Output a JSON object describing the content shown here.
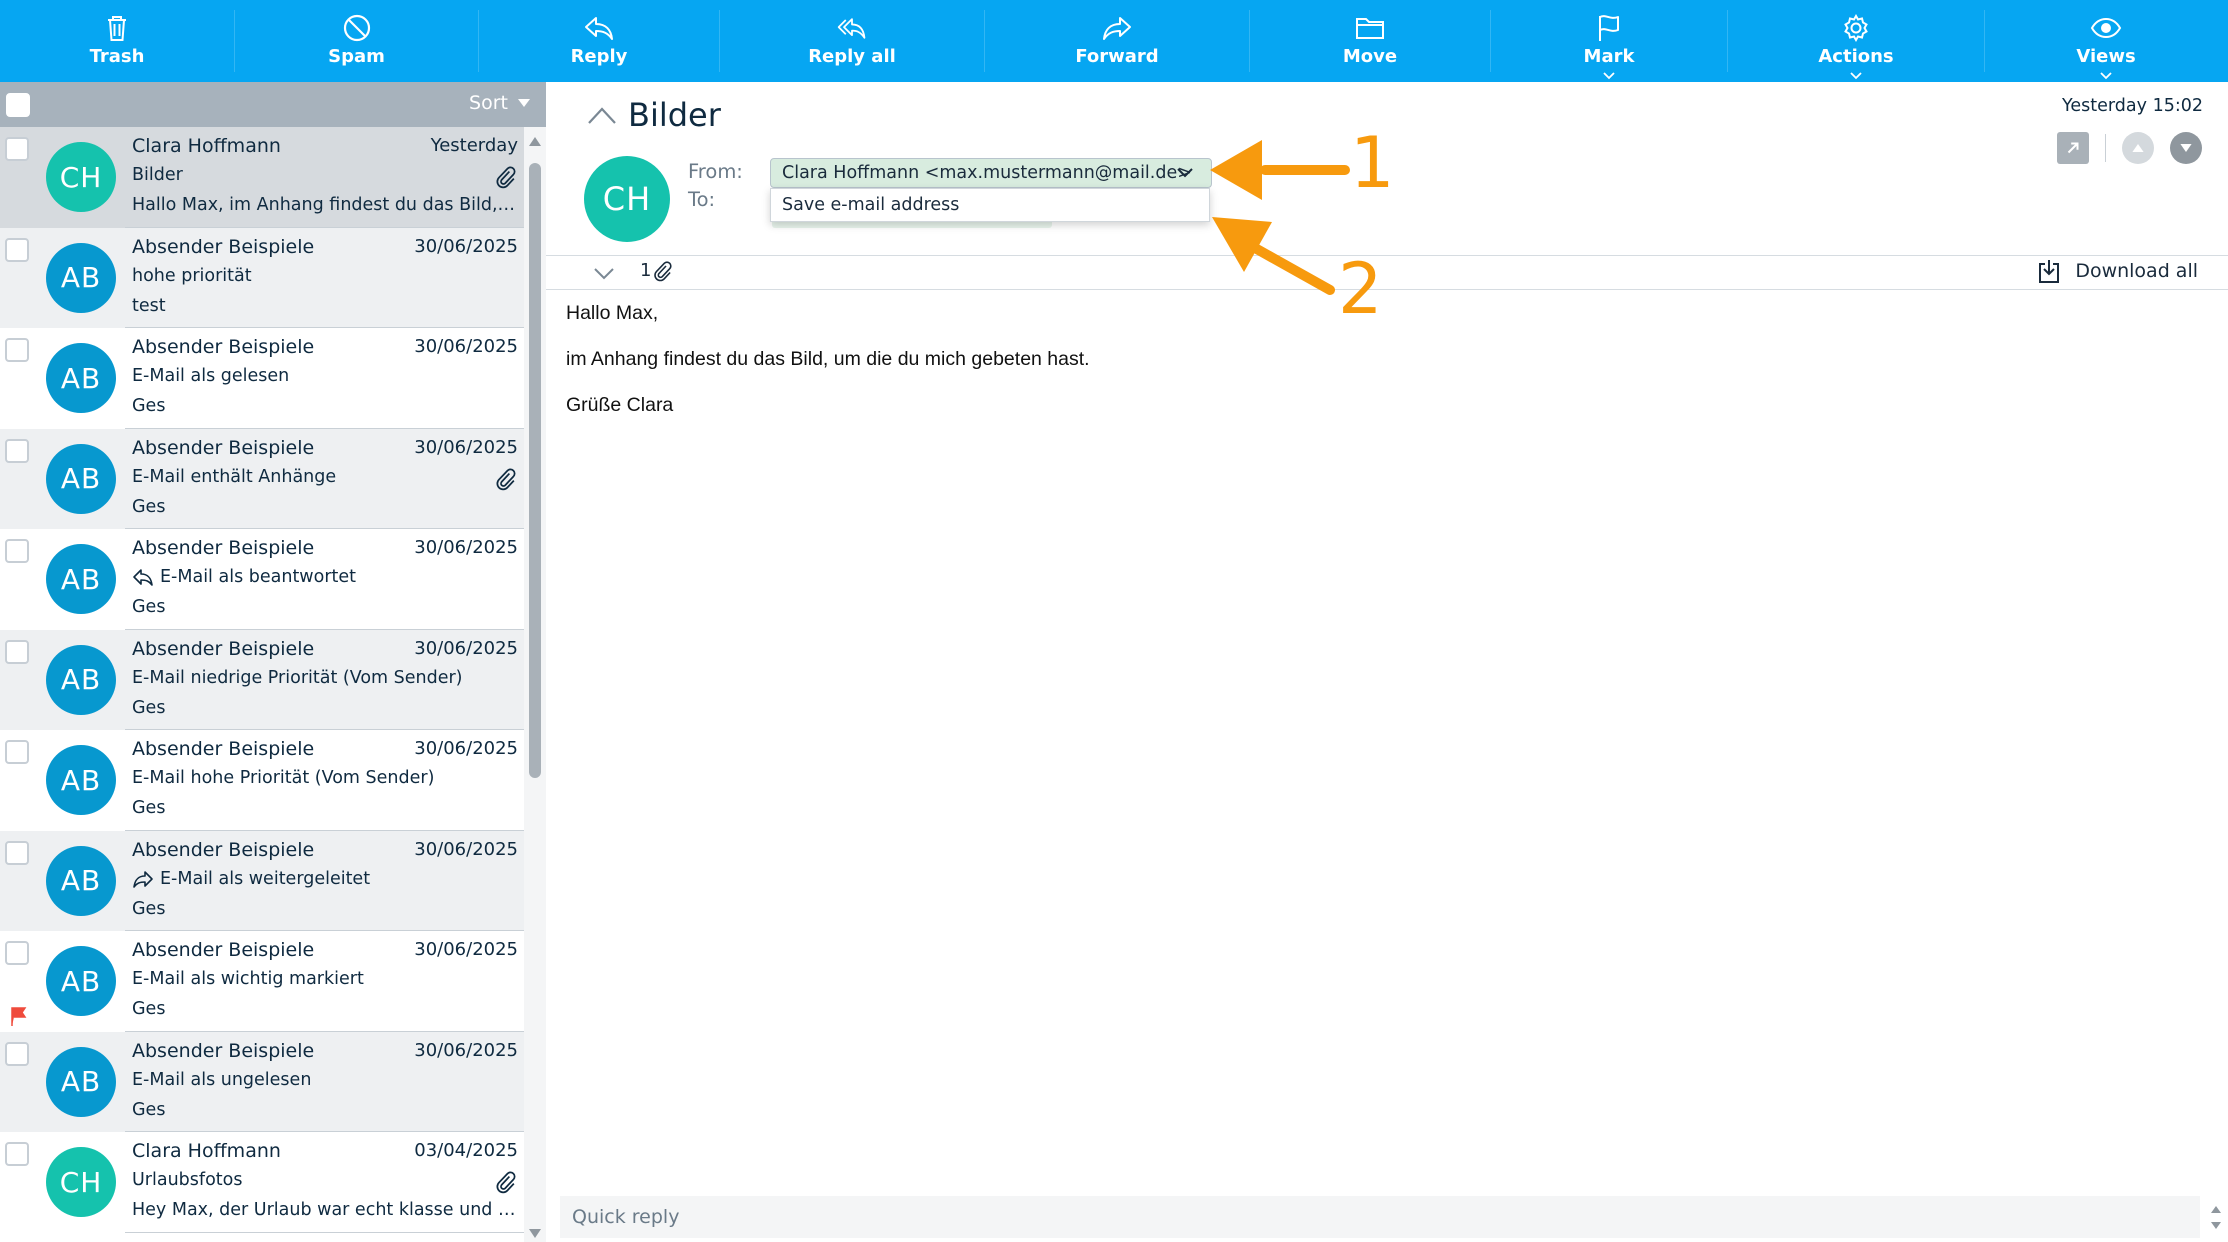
{
  "toolbar": {
    "buttons": [
      {
        "label": "Trash",
        "icon": "trash-icon"
      },
      {
        "label": "Spam",
        "icon": "spam-icon"
      },
      {
        "label": "Reply",
        "icon": "reply-icon"
      },
      {
        "label": "Reply all",
        "icon": "reply-all-icon"
      },
      {
        "label": "Forward",
        "icon": "forward-icon"
      },
      {
        "label": "Move",
        "icon": "folder-icon"
      },
      {
        "label": "Mark",
        "icon": "flag-icon"
      },
      {
        "label": "Actions",
        "icon": "gear-icon"
      },
      {
        "label": "Views",
        "icon": "eye-icon"
      }
    ]
  },
  "list": {
    "sort_label": "Sort",
    "messages": [
      {
        "initials": "CH",
        "sender": "Clara Hoffmann",
        "date": "Yesterday",
        "subject": "Bilder",
        "preview": "Hallo Max, im Anhang findest du das Bild, um die du mich gebeten hast.",
        "attachment": true,
        "color": "#15c2ad"
      },
      {
        "initials": "AB",
        "sender": "Absender Beispiele",
        "date": "30/06/2025",
        "subject": "hohe priorität",
        "preview": "test",
        "color": "#0798cf"
      },
      {
        "initials": "AB",
        "sender": "Absender Beispiele",
        "date": "30/06/2025",
        "subject": "E-Mail als gelesen",
        "preview": "Ges",
        "color": "#0798cf"
      },
      {
        "initials": "AB",
        "sender": "Absender Beispiele",
        "date": "30/06/2025",
        "subject": "E-Mail enthält Anhänge",
        "preview": "Ges",
        "attachment": true,
        "color": "#0798cf"
      },
      {
        "initials": "AB",
        "sender": "Absender Beispiele",
        "date": "30/06/2025",
        "subject": "E-Mail als beantwortet",
        "preview": "Ges",
        "subject_icon": "reply-icon",
        "color": "#0798cf"
      },
      {
        "initials": "AB",
        "sender": "Absender Beispiele",
        "date": "30/06/2025",
        "subject": "E-Mail niedrige Priorität (Vom Sender)",
        "preview": "Ges",
        "color": "#0798cf"
      },
      {
        "initials": "AB",
        "sender": "Absender Beispiele",
        "date": "30/06/2025",
        "subject": "E-Mail hohe Priorität (Vom Sender)",
        "preview": "Ges",
        "color": "#0798cf"
      },
      {
        "initials": "AB",
        "sender": "Absender Beispiele",
        "date": "30/06/2025",
        "subject": "E-Mail als weitergeleitet",
        "preview": "Ges",
        "subject_icon": "forward-icon",
        "color": "#0798cf"
      },
      {
        "initials": "AB",
        "sender": "Absender Beispiele",
        "date": "30/06/2025",
        "subject": "E-Mail als wichtig markiert",
        "preview": "Ges",
        "flagged": true,
        "color": "#0798cf"
      },
      {
        "initials": "AB",
        "sender": "Absender Beispiele",
        "date": "30/06/2025",
        "subject": "E-Mail als ungelesen",
        "preview": "Ges",
        "color": "#0798cf"
      },
      {
        "initials": "CH",
        "sender": "Clara Hoffmann",
        "date": "03/04/2025",
        "subject": "Urlaubsfotos",
        "preview": "Hey Max, der Urlaub war echt klasse und ich hoffe wir fahren bald wieder.",
        "attachment": true,
        "color": "#15c2ad"
      }
    ]
  },
  "mail": {
    "subject": "Bilder",
    "date": "Yesterday 15:02",
    "avatar_initials": "CH",
    "from_label": "From:",
    "to_label": "To:",
    "from_value": "Clara Hoffmann <max.mustermann@mail.de>",
    "dropdown_option": "Save e-mail address",
    "attachment_count": "1",
    "download_all": "Download all",
    "body": [
      "Hallo Max,",
      "im Anhang findest du das Bild, um die du mich gebeten hast.",
      "Grüße Clara"
    ],
    "quick_reply_placeholder": "Quick reply"
  },
  "annotations": {
    "label_1": "1",
    "label_2": "2",
    "color": "#f79a0e"
  },
  "colors": {
    "toolbar": "#06a6f2",
    "accent_teal": "#15c2ad",
    "accent_blue": "#0798cf",
    "flag": "#ef4b3c"
  }
}
